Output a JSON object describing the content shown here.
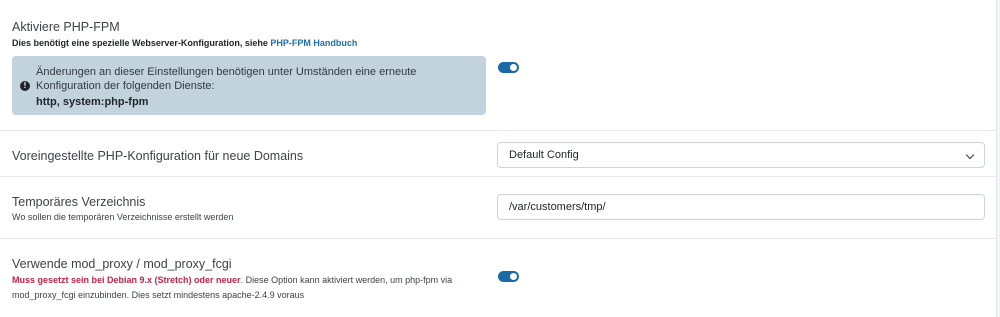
{
  "php_fpm": {
    "label": "Aktiviere PHP-FPM",
    "desc_prefix": "Dies benötigt eine spezielle Webserver-Konfiguration, siehe ",
    "desc_link": "PHP-FPM Handbuch",
    "alert_text": "Änderungen an dieser Einstellungen benötigen unter Umständen eine erneute Konfiguration der folgenden Dienste:",
    "alert_services": "http, system:php-fpm",
    "alert_icon": "exclamation-circle-icon",
    "enabled": true
  },
  "default_config": {
    "label": "Voreingestellte PHP-Konfiguration für neue Domains",
    "selected": "Default Config"
  },
  "tmp_dir": {
    "label": "Temporäres Verzeichnis",
    "desc": "Wo sollen die temporären Verzeichnisse erstellt werden",
    "value": "/var/customers/tmp/"
  },
  "mod_proxy": {
    "label": "Verwende mod_proxy / mod_proxy_fcgi",
    "desc_warning": "Muss gesetzt sein bei Debian 9.x (Stretch) oder neuer",
    "desc_rest": ". Diese Option kann aktiviert werden, um php-fpm via mod_proxy_fcgi einzubinden. Dies setzt mindestens apache-2.4.9 voraus",
    "enabled": true
  },
  "colors": {
    "accent": "#1a6aa8",
    "warning": "#c72146",
    "link": "#1f6fb2",
    "alert_bg": "#c2d3de"
  }
}
